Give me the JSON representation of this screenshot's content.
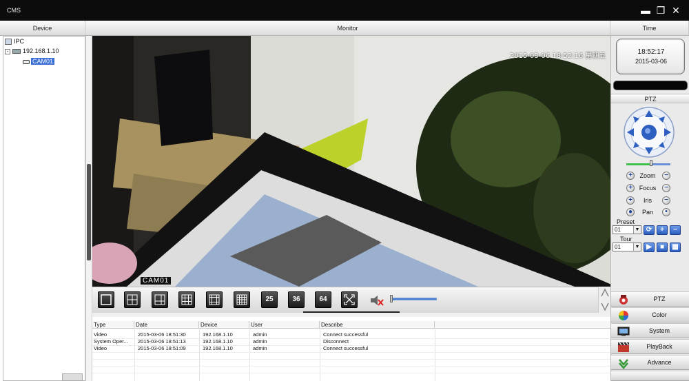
{
  "window": {
    "title": "CMS",
    "minimize_icon": "minimize-icon",
    "restore_icon": "restore-icon",
    "close_icon": "close-icon"
  },
  "headers": {
    "device": "Device",
    "monitor": "Monitor",
    "time": "Time"
  },
  "device_tree": {
    "root": "IPC",
    "device": "192.168.1.10",
    "camera": "CAM01",
    "expand_symbol": "⊟"
  },
  "video": {
    "timestamp": "2015-03-06 18:52:16 星期五",
    "camera_label": "CAM01"
  },
  "layout_buttons": [
    "25",
    "36",
    "64"
  ],
  "log": {
    "columns": [
      "Type",
      "Date",
      "Device",
      "User",
      "Describe"
    ],
    "rows": [
      [
        "Video",
        "2015-03-06 18:51:30",
        "192.168.1.10",
        "admin",
        "Connect successful"
      ],
      [
        "System Oper...",
        "2015-03-06 18:51:13",
        "192.168.1.10",
        "admin",
        "Disconnect"
      ],
      [
        "Video",
        "2015-03-06 18:51:09",
        "192.168.1.10",
        "admin",
        "Connect successful"
      ]
    ]
  },
  "clock": {
    "time": "18:52:17",
    "date": "2015-03-06"
  },
  "ptz": {
    "title": "PTZ",
    "controls": [
      "Zoom",
      "Focus",
      "Iris",
      "Pan"
    ],
    "preset_label": "Preset",
    "preset_value": "01",
    "tour_label": "Tour",
    "tour_value": "01"
  },
  "menu": [
    "PTZ",
    "Color",
    "System",
    "PlayBack",
    "Advance"
  ],
  "colors": {
    "accent": "#3b6fd8",
    "ptz_blue": "#2d5fc1",
    "titlebar": "#0c0c0c"
  }
}
